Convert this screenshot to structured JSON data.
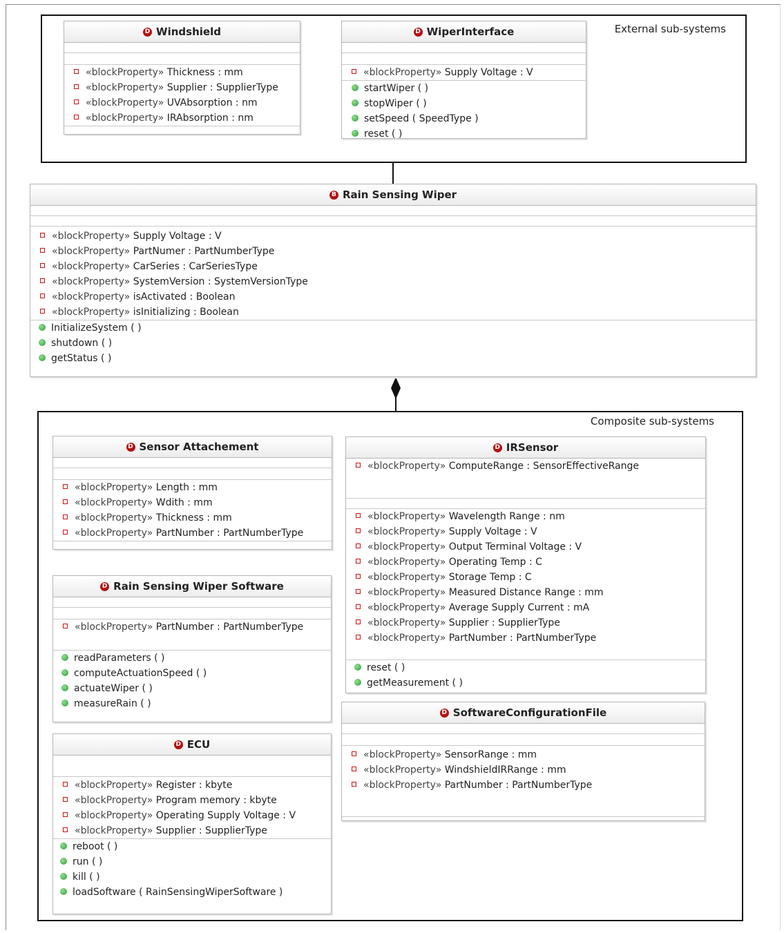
{
  "packages": {
    "external": {
      "label": "External sub-systems"
    },
    "composite": {
      "label": "Composite sub-systems"
    }
  },
  "stereotype": "«blockProperty»",
  "blocks": {
    "windshield": {
      "name": "Windshield",
      "badge": "D",
      "properties": [
        "Thickness : mm",
        "Supplier : SupplierType",
        "UVAbsorption : nm",
        "IRAbsorption : nm"
      ],
      "operations": []
    },
    "wiper_interface": {
      "name": "WiperInterface",
      "badge": "D",
      "properties": [
        "Supply Voltage : V"
      ],
      "operations": [
        "startWiper ( )",
        "stopWiper ( )",
        "setSpeed ( SpeedType )",
        "reset ( )"
      ]
    },
    "rain_sensing_wiper": {
      "name": "Rain Sensing Wiper",
      "badge": "B",
      "properties": [
        "Supply Voltage : V",
        "PartNumer : PartNumberType",
        "CarSeries : CarSeriesType",
        "SystemVersion : SystemVersionType",
        "isActivated : Boolean",
        "isInitializing : Boolean"
      ],
      "operations": [
        "InitializeSystem ( )",
        "shutdown ( )",
        "getStatus ( )"
      ]
    },
    "sensor_attachement": {
      "name": "Sensor Attachement",
      "badge": "D",
      "properties": [
        "Length : mm",
        "Wdith : mm",
        "Thickness : mm",
        "PartNumber : PartNumberType"
      ],
      "operations": []
    },
    "ir_sensor": {
      "name": "IRSensor",
      "badge": "D",
      "properties_top": [
        "ComputeRange : SensorEffectiveRange"
      ],
      "properties": [
        "Wavelength Range : nm",
        "Supply Voltage : V",
        "Output Terminal Voltage : V",
        "Operating Temp : C",
        "Storage Temp : C",
        "Measured Distance Range : mm",
        "Average Supply Current : mA",
        "Supplier : SupplierType",
        "PartNumber : PartNumberType"
      ],
      "operations": [
        "reset ( )",
        "getMeasurement ( )"
      ]
    },
    "rsw_software": {
      "name": "Rain Sensing Wiper Software",
      "badge": "D",
      "properties": [
        "PartNumber : PartNumberType"
      ],
      "operations": [
        "readParameters ( )",
        "computeActuationSpeed ( )",
        "actuateWiper ( )",
        "measureRain ( )"
      ]
    },
    "software_config_file": {
      "name": "SoftwareConfigurationFile",
      "badge": "D",
      "properties": [
        "SensorRange : mm",
        "WindshieldIRRange : mm",
        "PartNumber : PartNumberType"
      ],
      "operations": []
    },
    "ecu": {
      "name": "ECU",
      "badge": "D",
      "properties": [
        "Register : kbyte",
        "Program memory : kbyte",
        "Operating Supply Voltage : V",
        "Supplier : SupplierType"
      ],
      "operations": [
        "reboot ( )",
        "run ( )",
        "kill ( )",
        "loadSoftware ( RainSensingWiperSoftware )"
      ]
    }
  }
}
